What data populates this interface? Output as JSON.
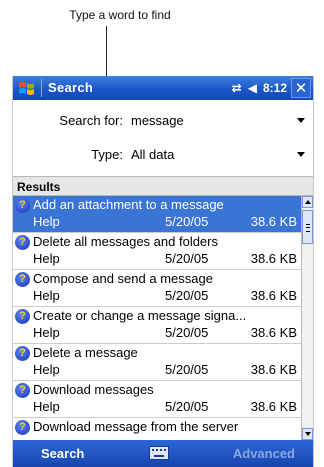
{
  "callout": {
    "text": "Type a word to find"
  },
  "titlebar": {
    "title": "Search",
    "time": "8:12",
    "close": "✕"
  },
  "form": {
    "search_label": "Search for:",
    "search_value": "message",
    "type_label": "Type:",
    "type_value": "All data"
  },
  "results": {
    "header": "Results",
    "items": [
      {
        "title": "Add an attachment to a message",
        "category": "Help",
        "date": "5/20/05",
        "size": "38.6 KB",
        "selected": true
      },
      {
        "title": "Delete all messages and folders",
        "category": "Help",
        "date": "5/20/05",
        "size": "38.6 KB"
      },
      {
        "title": "Compose and send a message",
        "category": "Help",
        "date": "5/20/05",
        "size": "38.6 KB"
      },
      {
        "title": "Create or change a message signa...",
        "category": "Help",
        "date": "5/20/05",
        "size": "38.6 KB"
      },
      {
        "title": "Delete a message",
        "category": "Help",
        "date": "5/20/05",
        "size": "38.6 KB"
      },
      {
        "title": "Download messages",
        "category": "Help",
        "date": "5/20/05",
        "size": "38.6 KB"
      },
      {
        "title": "Download message from the server",
        "category": "",
        "date": "",
        "size": ""
      }
    ]
  },
  "bottombar": {
    "left": "Search",
    "right": "Advanced"
  },
  "colors": {
    "titlebar": "#1a56c8",
    "selection": "#3a74d4"
  },
  "icons": [
    "windows-flag-icon",
    "connectivity-icon",
    "speaker-icon",
    "close-icon",
    "help-icon",
    "keyboard-icon"
  ]
}
